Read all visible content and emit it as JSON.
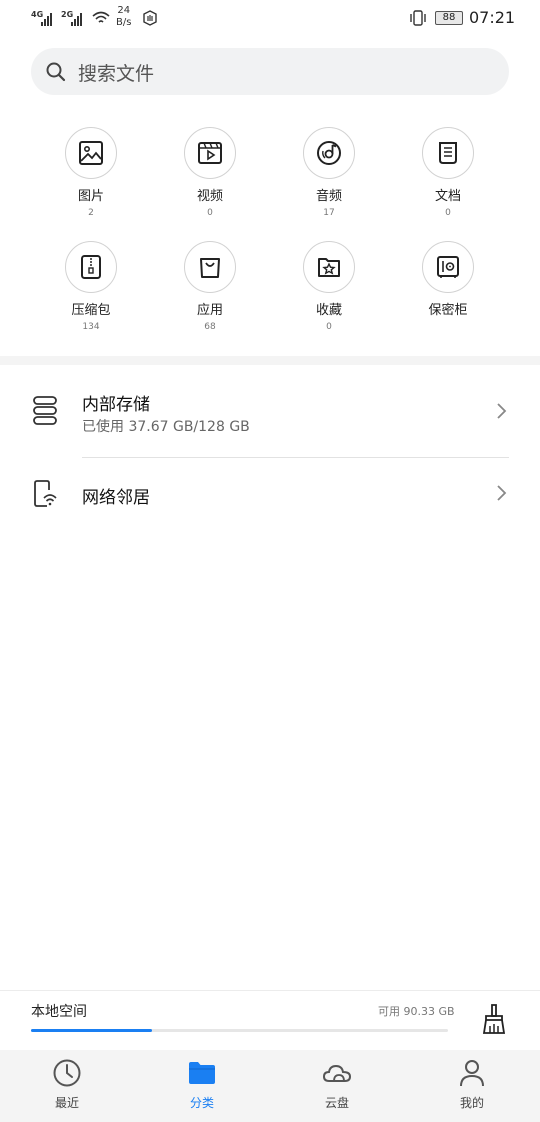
{
  "status_bar": {
    "signal1_label": "4G",
    "signal2_label": "2G",
    "net_speed_value": "24",
    "net_speed_unit": "B/s",
    "battery": "88",
    "time": "07:21"
  },
  "search": {
    "placeholder": "搜索文件"
  },
  "categories": [
    {
      "label": "图片",
      "count": "2",
      "icon": "image-icon"
    },
    {
      "label": "视频",
      "count": "0",
      "icon": "video-icon"
    },
    {
      "label": "音频",
      "count": "17",
      "icon": "audio-icon"
    },
    {
      "label": "文档",
      "count": "0",
      "icon": "document-icon"
    },
    {
      "label": "压缩包",
      "count": "134",
      "icon": "zip-icon"
    },
    {
      "label": "应用",
      "count": "68",
      "icon": "app-bag-icon"
    },
    {
      "label": "收藏",
      "count": "0",
      "icon": "favorite-folder-icon"
    },
    {
      "label": "保密柜",
      "count": "",
      "icon": "safe-icon"
    }
  ],
  "storage": {
    "internal_title": "内部存储",
    "internal_usage": "已使用 37.67 GB/128 GB",
    "network_title": "网络邻居"
  },
  "local_space": {
    "label": "本地空间",
    "available": "可用 90.33 GB",
    "used_fraction": 0.29
  },
  "nav": {
    "recent": "最近",
    "category": "分类",
    "cloud": "云盘",
    "mine": "我的",
    "active_color": "#1a7ff2"
  }
}
